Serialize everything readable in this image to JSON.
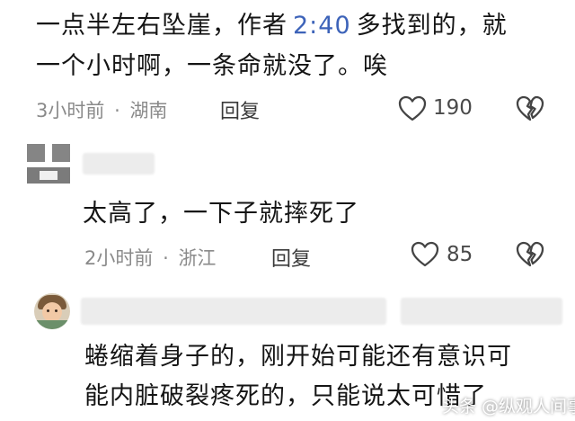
{
  "comments": [
    {
      "line1_before": "一点半左右坠崖，作者",
      "line1_time": "2:40",
      "line1_after": "多找到的，就",
      "line2": "一个小时啊，一条命就没了。唉",
      "meta_time": "3小时前",
      "meta_sep": "·",
      "meta_location": "湖南",
      "reply_label": "回复",
      "likes": "190"
    },
    {
      "text": "太高了，一下子就摔死了",
      "meta_time": "2小时前",
      "meta_sep": "·",
      "meta_location": "浙江",
      "reply_label": "回复",
      "likes": "85"
    },
    {
      "line1": "蜷缩着身子的，刚开始可能还有意识可",
      "line2": "能内脏破裂疼死的，只能说太可惜了"
    }
  ],
  "watermark": "头条 @纵观人间事",
  "icons": [
    "heart-icon",
    "broken-heart-icon",
    "avatar"
  ],
  "colors": {
    "accent": "#3d63b9",
    "meta": "#8a8a8a",
    "text": "#151515"
  }
}
